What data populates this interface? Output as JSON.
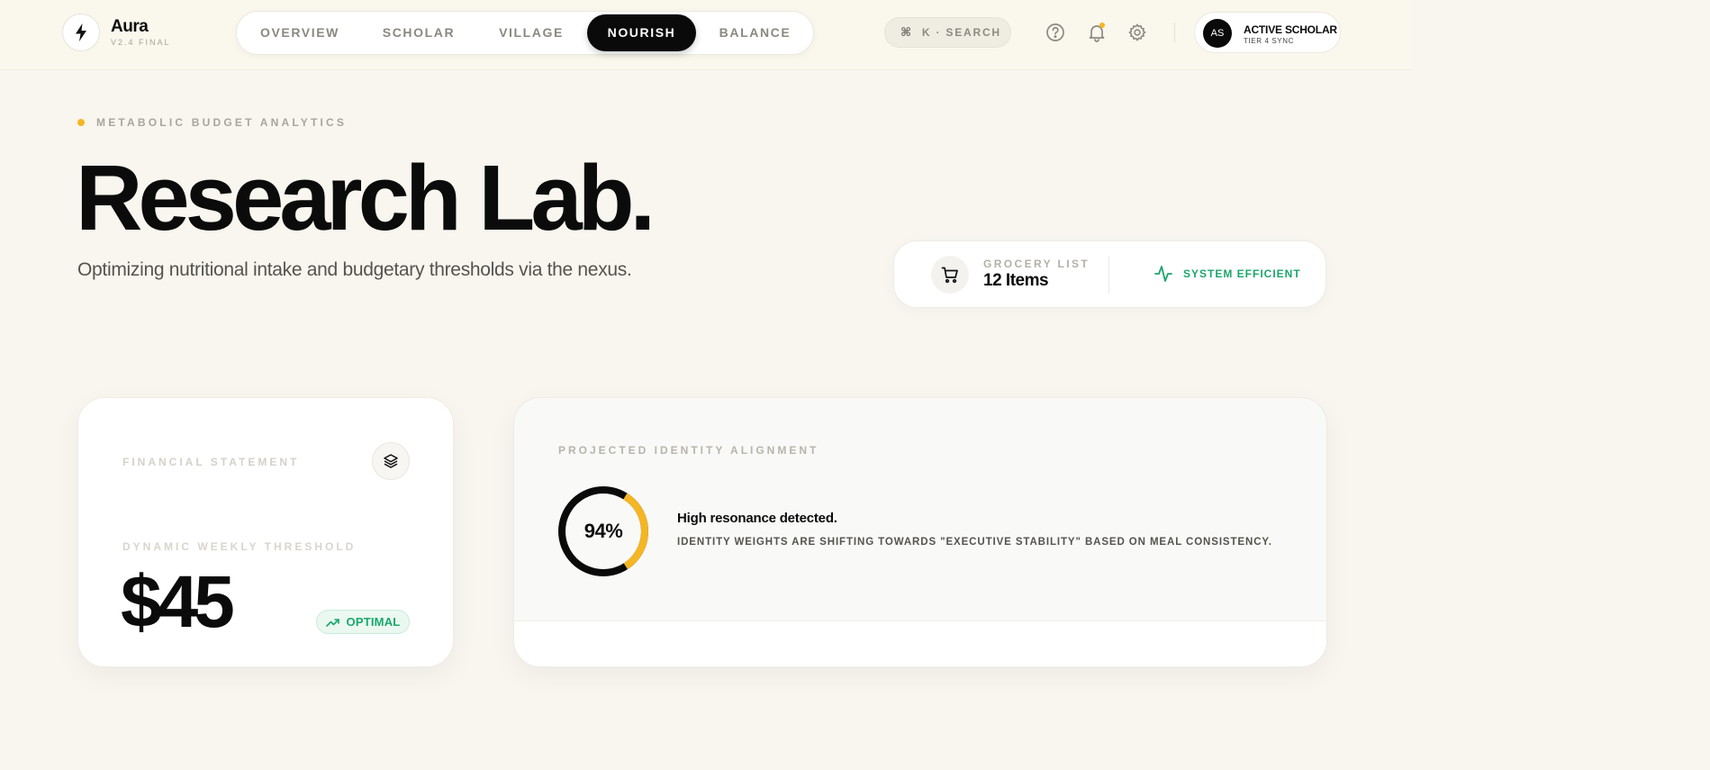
{
  "brand": {
    "name": "Aura",
    "version": "V2.4 FINAL"
  },
  "nav": {
    "items": [
      {
        "label": "OVERVIEW"
      },
      {
        "label": "SCHOLAR"
      },
      {
        "label": "VILLAGE"
      },
      {
        "label": "NOURISH",
        "active": true
      },
      {
        "label": "BALANCE"
      }
    ]
  },
  "search": {
    "shortcut": "⌘",
    "label": "K · SEARCH"
  },
  "header_icons": [
    "help-icon",
    "bell-icon",
    "gear-icon"
  ],
  "profile": {
    "initials": "AS",
    "name": "ACTIVE SCHOLAR",
    "tier": "TIER 4 SYNC"
  },
  "hero": {
    "eyebrow": "METABOLIC BUDGET ANALYTICS",
    "title": "Research Lab.",
    "subtitle": "Optimizing nutritional intake and budgetary thresholds via the nexus."
  },
  "grocery": {
    "label": "GROCERY LIST",
    "count": "12 Items",
    "status": "SYSTEM EFFICIENT"
  },
  "financial": {
    "label": "FINANCIAL STATEMENT",
    "threshold_label": "DYNAMIC WEEKLY THRESHOLD",
    "amount": "$45",
    "badge": "OPTIMAL"
  },
  "alignment": {
    "label": "PROJECTED IDENTITY ALIGNMENT",
    "percent_text": "94%",
    "percent": 0.94,
    "headline": "High resonance detected.",
    "description": "IDENTITY WEIGHTS ARE SHIFTING TOWARDS \"EXECUTIVE STABILITY\" BASED ON MEAL CONSISTENCY."
  },
  "colors": {
    "accent": "#f5b623",
    "success": "#1aa76b",
    "dark": "#0a0a0a",
    "background": "#f8f6ef"
  }
}
